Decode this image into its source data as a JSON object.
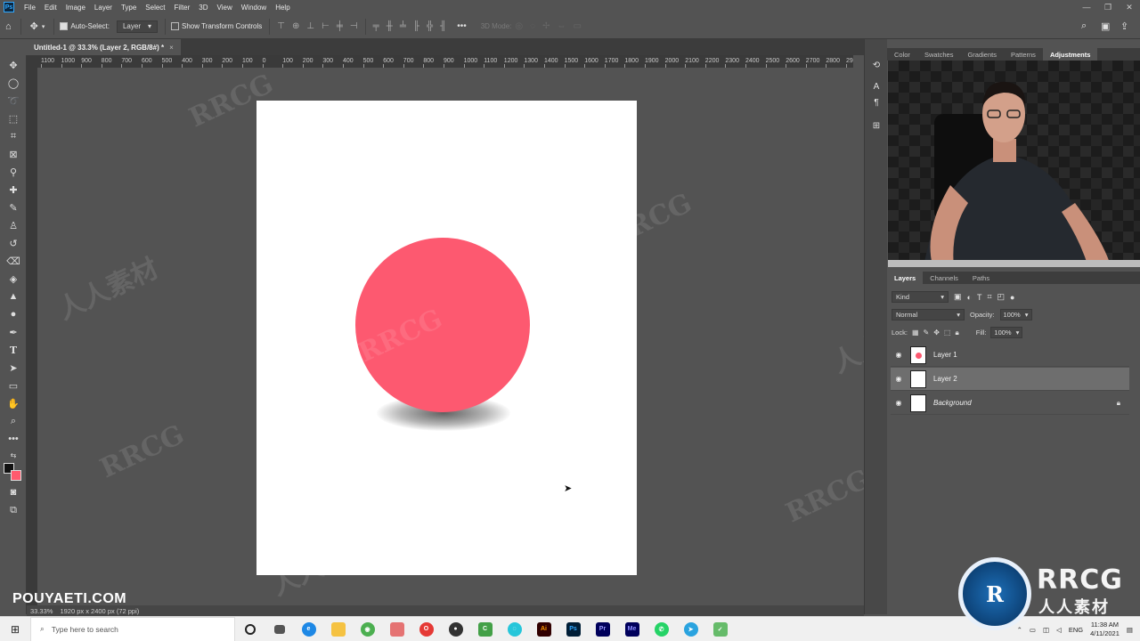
{
  "menu": [
    "File",
    "Edit",
    "Image",
    "Layer",
    "Type",
    "Select",
    "Filter",
    "3D",
    "View",
    "Window",
    "Help"
  ],
  "options_bar": {
    "auto_select_label": "Auto-Select:",
    "auto_select_value": "Layer",
    "show_transform_label": "Show Transform Controls",
    "mode_3d_label": "3D Mode:"
  },
  "document": {
    "tab_title": "Untitled-1 @ 33.3% (Layer 2, RGB/8#) *",
    "zoom": "33.33%",
    "dimensions": "1920 px x 2400 px (72 ppi)"
  },
  "ruler_labels": [
    "1100",
    "1000",
    "900",
    "800",
    "700",
    "600",
    "500",
    "400",
    "300",
    "200",
    "100",
    "0",
    "100",
    "200",
    "300",
    "400",
    "500",
    "600",
    "700",
    "800",
    "900",
    "1000",
    "1100",
    "1200",
    "1300",
    "1400",
    "1500",
    "1600",
    "1700",
    "1800",
    "1900",
    "2000",
    "2100",
    "2200",
    "2300",
    "2400",
    "2500",
    "2600",
    "2700",
    "2800",
    "2900"
  ],
  "panel_tabs": [
    "Color",
    "Swatches",
    "Gradients",
    "Patterns",
    "Adjustments"
  ],
  "active_panel_tab": "Adjustments",
  "layers_panel": {
    "tabs": [
      "Layers",
      "Channels",
      "Paths"
    ],
    "kind_label": "Kind",
    "blend_mode": "Normal",
    "opacity_label": "Opacity:",
    "opacity_value": "100%",
    "lock_label": "Lock:",
    "fill_label": "Fill:",
    "fill_value": "100%",
    "layers": [
      {
        "name": "Layer 1",
        "selected": false,
        "italic": false,
        "locked": false
      },
      {
        "name": "Layer 2",
        "selected": true,
        "italic": false,
        "locked": false
      },
      {
        "name": "Background",
        "selected": false,
        "italic": true,
        "locked": true
      }
    ]
  },
  "colors": {
    "foreground": "#111111",
    "background": "#ff5b6e",
    "circle_fill": "#fd5970"
  },
  "watermark_text": "POUYAETI.COM",
  "overlay_watermarks": [
    "RRCG",
    "人人素材"
  ],
  "taskbar": {
    "search_placeholder": "Type here to search",
    "language": "ENG",
    "time": "11:38 AM",
    "date": "4/11/2021"
  },
  "brand": {
    "logo_text": "RRCG",
    "logo_sub": "人人素材"
  }
}
